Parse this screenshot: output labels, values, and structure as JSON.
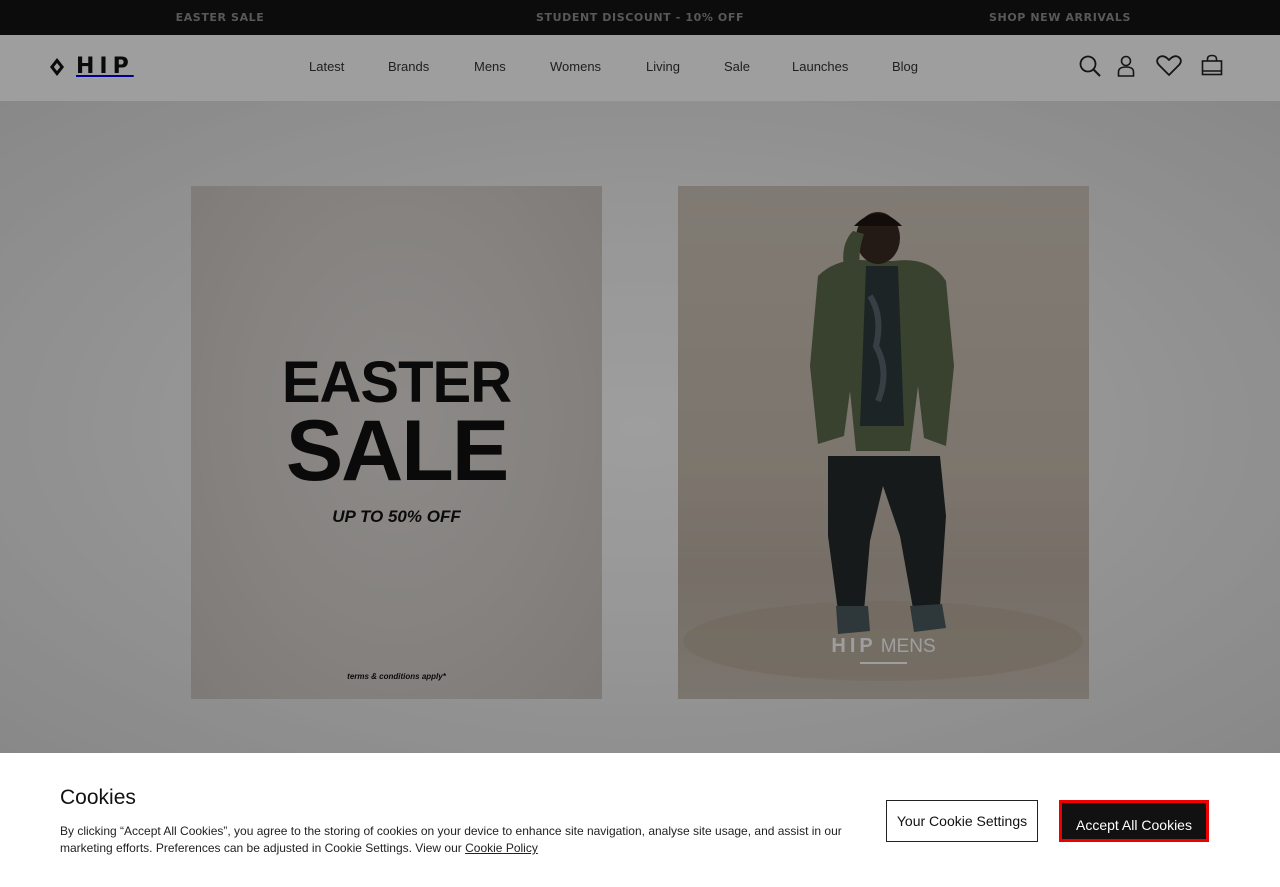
{
  "announcement_bar": {
    "items": [
      "EASTER SALE",
      "STUDENT DISCOUNT - 10% OFF",
      "SHOP NEW ARRIVALS"
    ]
  },
  "header": {
    "logo_text": "HIP",
    "nav": [
      "Latest",
      "Brands",
      "Mens",
      "Womens",
      "Living",
      "Sale",
      "Launches",
      "Blog"
    ],
    "icons": [
      "search-icon",
      "account-icon",
      "wishlist-heart-icon",
      "bag-icon"
    ]
  },
  "hero": {
    "sale_card": {
      "line1": "EASTER",
      "line2": "SALE",
      "offer": "UP TO 50% OFF",
      "terms": "terms & conditions apply*"
    },
    "mens_card": {
      "brand": "HIP",
      "label": "MENS"
    }
  },
  "cookie_banner": {
    "title": "Cookies",
    "body": "By clicking “Accept All Cookies”, you agree to the storing of cookies on your device to enhance site navigation, analyse site usage, and assist in our marketing efforts. Preferences can be adjusted in Cookie Settings. View our ",
    "policy_link": "Cookie Policy",
    "settings_button": "Your Cookie Settings",
    "accept_button": "Accept All Cookies"
  },
  "colors": {
    "topbar_bg": "#141414",
    "topbar_text": "#8f8f8f",
    "accept_border": "#ee0000",
    "accept_bg": "#111111"
  }
}
